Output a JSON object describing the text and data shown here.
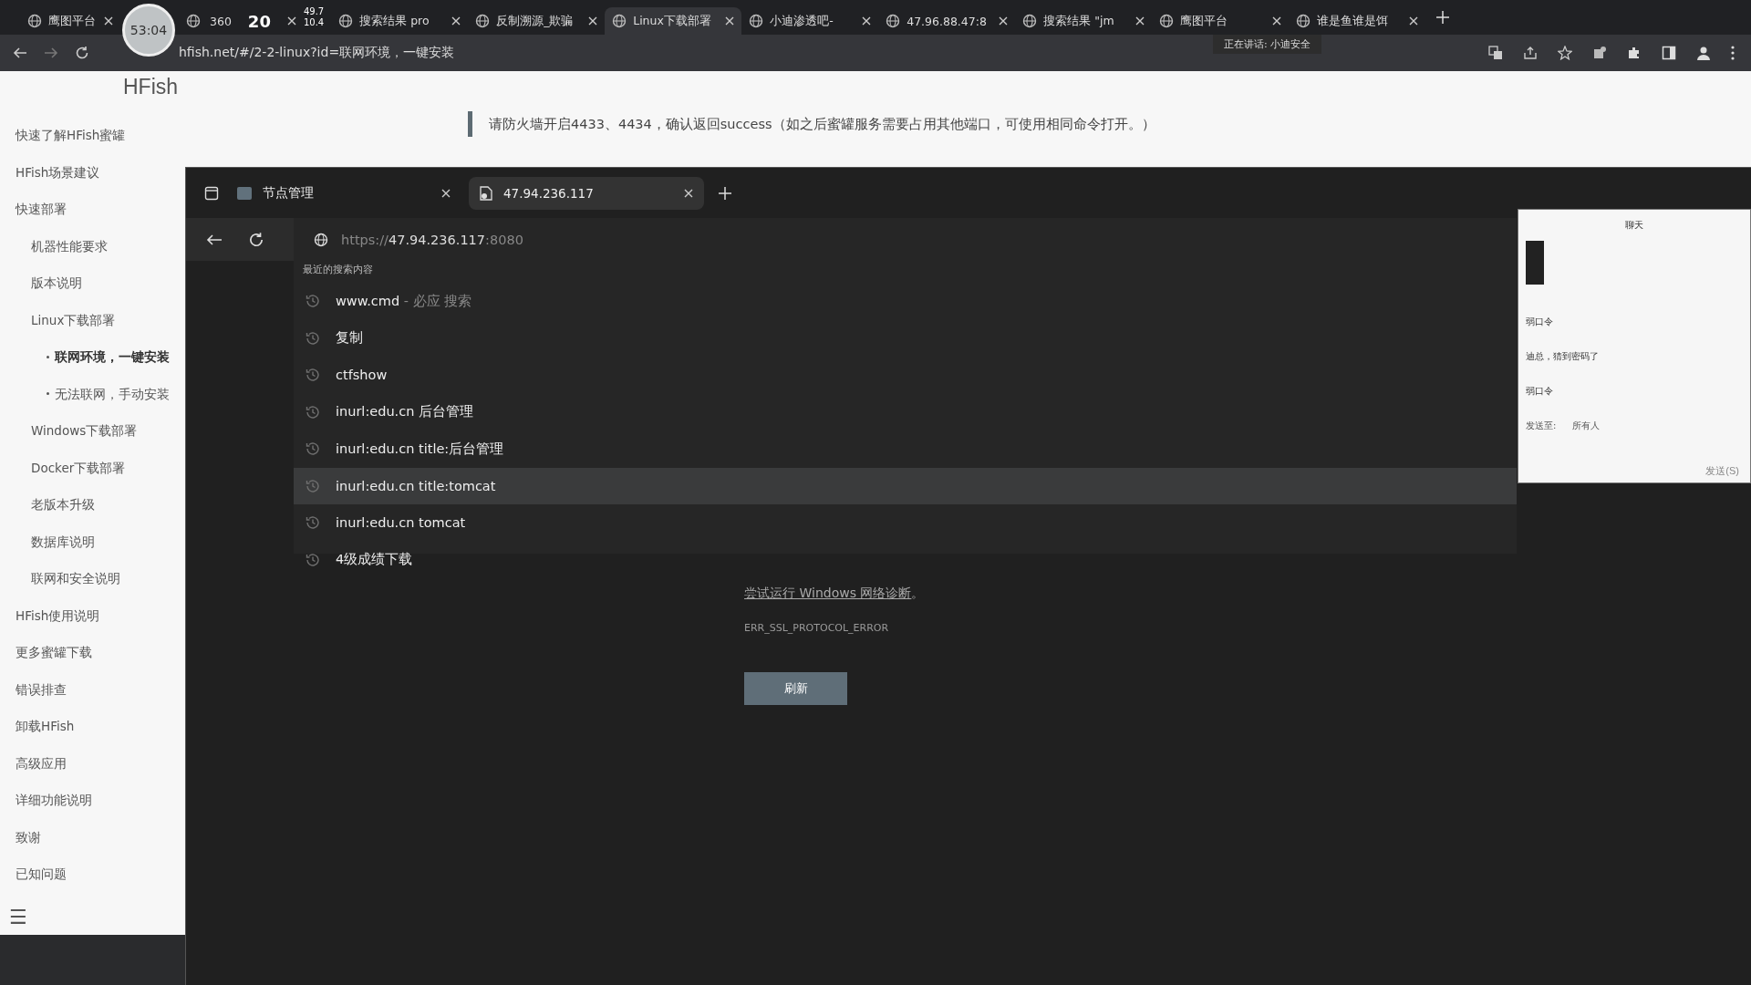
{
  "browser_tabs": [
    {
      "title": "鹰图平台",
      "selected": false
    },
    {
      "title": "360",
      "selected": false
    },
    {
      "title": "搜索结果 pro",
      "selected": false
    },
    {
      "title": "反制溯源_欺骗",
      "selected": false
    },
    {
      "title": "Linux下载部署",
      "selected": true
    },
    {
      "title": "小迪渗透吧-",
      "selected": false
    },
    {
      "title": "47.96.88.47:8",
      "selected": false
    },
    {
      "title": "搜索结果 \"jm",
      "selected": false
    },
    {
      "title": "鹰图平台",
      "selected": false
    },
    {
      "title": "谁是鱼谁是饵",
      "selected": false
    }
  ],
  "address_bar": {
    "url": "hfish.net/#/2-2-linux?id=联网环境，一键安装"
  },
  "overlays": {
    "timer": "53:04",
    "counter": "20",
    "net_up": "49.7",
    "net_down": "10.4",
    "speaking": "正在讲话: 小迪安全"
  },
  "page": {
    "logo": "HFish",
    "notice": "请防火墙开启4433、4434，确认返回success（如之后蜜罐服务需要占用其他端口，可使用相同命令打开。）"
  },
  "sidebar": {
    "items": [
      {
        "label": "快速了解HFish蜜罐",
        "selected": false
      },
      {
        "label": "HFish场景建议",
        "selected": false
      },
      {
        "label": "快速部署",
        "selected": false,
        "children": [
          {
            "label": "机器性能要求",
            "selected": false
          },
          {
            "label": "版本说明",
            "selected": false
          },
          {
            "label": "Linux下载部署",
            "selected": false,
            "children": [
              {
                "label": "联网环境，一键安装",
                "selected": true
              },
              {
                "label": "无法联网，手动安装",
                "selected": false
              }
            ]
          },
          {
            "label": "Windows下载部署",
            "selected": false
          },
          {
            "label": "Docker下载部署",
            "selected": false
          },
          {
            "label": "老版本升级",
            "selected": false
          },
          {
            "label": "数据库说明",
            "selected": false
          },
          {
            "label": "联网和安全说明",
            "selected": false
          }
        ]
      },
      {
        "label": "HFish使用说明",
        "selected": false
      },
      {
        "label": "更多蜜罐下载",
        "selected": false
      },
      {
        "label": "错误排查",
        "selected": false
      },
      {
        "label": "卸载HFish",
        "selected": false
      },
      {
        "label": "高级应用",
        "selected": false
      },
      {
        "label": "详细功能说明",
        "selected": false
      },
      {
        "label": "致谢",
        "selected": false
      },
      {
        "label": "已知问题",
        "selected": false
      }
    ],
    "menu_glyph": "☰"
  },
  "edge_window": {
    "tabs": [
      {
        "title": "节点管理",
        "selected": false
      },
      {
        "title": "47.94.236.117",
        "selected": true
      }
    ],
    "omnibox": {
      "scheme": "https://",
      "host": "47.94.236.117",
      "port": ":8080"
    },
    "suggestions_header": "最近的搜索内容",
    "suggestions": [
      {
        "text": "www.cmd",
        "suffix": " - 必应 搜索",
        "selected": false
      },
      {
        "text": "复制",
        "selected": false
      },
      {
        "text": "ctfshow",
        "selected": false
      },
      {
        "text": "inurl:edu.cn 后台管理",
        "selected": false
      },
      {
        "text": "inurl:edu.cn title:后台管理",
        "selected": false
      },
      {
        "text": "inurl:edu.cn title:tomcat",
        "selected": true
      },
      {
        "text": "inurl:edu.cn tomcat",
        "selected": false
      },
      {
        "text": "4级成绩下载",
        "selected": false
      }
    ],
    "error": {
      "link": "尝试运行 Windows 网络诊断",
      "link_end": "。",
      "code": "ERR_SSL_PROTOCOL_ERROR",
      "button": "刷新"
    }
  },
  "chat_window": {
    "title": "聊天",
    "messages": [
      "弱口令",
      "迪总，猜到密码了",
      "弱口令"
    ],
    "send_to_label": "发送至:",
    "send_to_value": "所有人",
    "send_button": "发送(S)"
  }
}
